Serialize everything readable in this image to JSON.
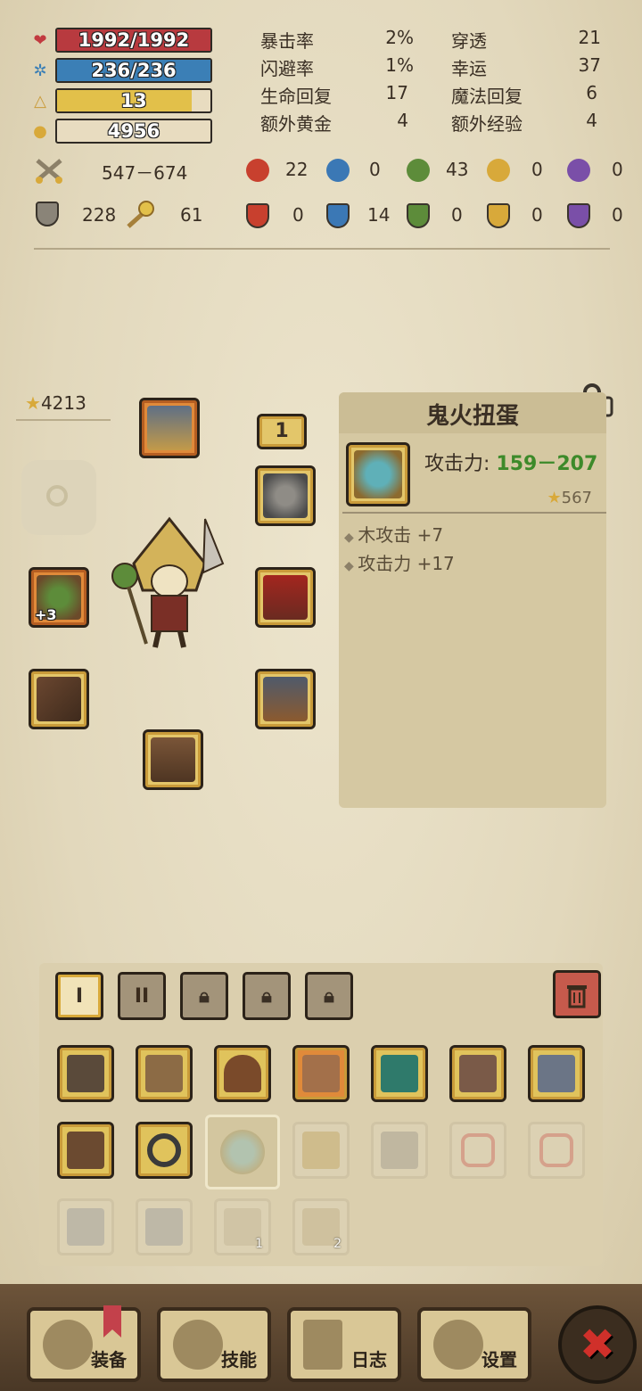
{
  "bars": {
    "hp": {
      "text": "1992/1992",
      "fill": 1.0,
      "color": "#b83a3f",
      "icon": "heart-icon"
    },
    "mp": {
      "text": "236/236",
      "fill": 1.0,
      "color": "#3b7fb6",
      "icon": "mana-gear-icon"
    },
    "level": {
      "text": "13",
      "fill": 0.88,
      "color": "#e2c04a",
      "icon": "level-triangle-icon"
    },
    "gold": {
      "text": "4956",
      "fill": 0.0,
      "color": "#e2c04a",
      "icon": "gold-pile-icon"
    }
  },
  "stats": [
    {
      "label": "暴击率",
      "value": "2%"
    },
    {
      "label": "闪避率",
      "value": "1%"
    },
    {
      "label": "生命回复",
      "value": "17"
    },
    {
      "label": "额外黄金",
      "value": "4"
    },
    {
      "label": "穿透",
      "value": "21"
    },
    {
      "label": "幸运",
      "value": "37"
    },
    {
      "label": "魔法回复",
      "value": "6"
    },
    {
      "label": "额外经验",
      "value": "4"
    }
  ],
  "attack_range": "547－674",
  "defense": "228",
  "magic_defense": "61",
  "elements_attack": [
    "22",
    "0",
    "43",
    "0",
    "0"
  ],
  "elements_defense": [
    "0",
    "14",
    "0",
    "0",
    "0"
  ],
  "element_colors": [
    "#c8402e",
    "#3b78b5",
    "#5d8c3a",
    "#d8a93a",
    "#7a4fa8"
  ],
  "gear_score": "4213",
  "slot_badge": "1",
  "weapon_plus": "+3",
  "item": {
    "name": "鬼火扭蛋",
    "attack_label": "攻击力: ",
    "attack_value": "159－207",
    "score": "567",
    "affixes": [
      "木攻击 +7",
      "攻击力 +17"
    ]
  },
  "tabs": [
    "I",
    "II"
  ],
  "inventory_badges": [
    "1",
    "2"
  ],
  "nav": [
    {
      "label": "装备",
      "icon": "equipment-axe-icon"
    },
    {
      "label": "技能",
      "icon": "skills-icon"
    },
    {
      "label": "日志",
      "icon": "log-icon"
    },
    {
      "label": "设置",
      "icon": "settings-gear-icon"
    }
  ],
  "close_icon": "✖"
}
